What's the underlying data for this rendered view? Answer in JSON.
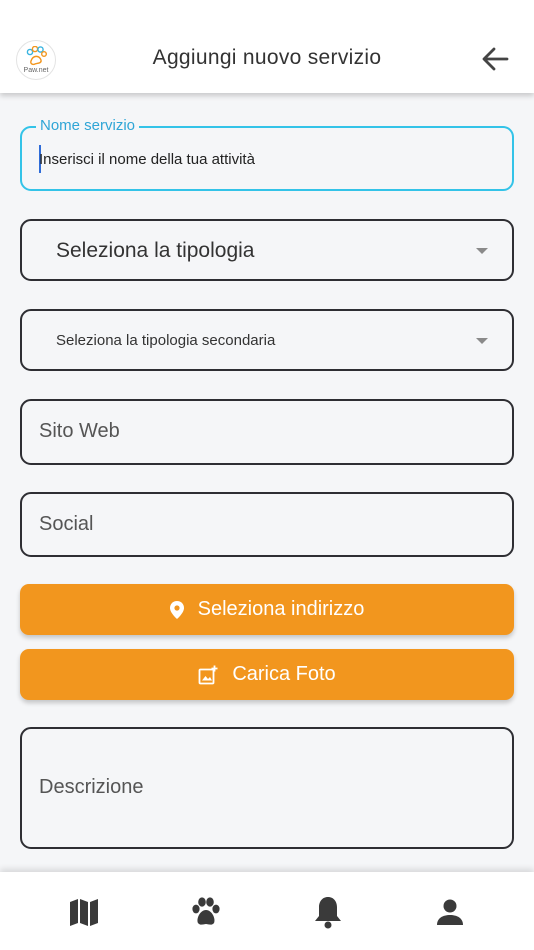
{
  "header": {
    "logo_text": "Paw.net",
    "title": "Aggiungi nuovo servizio"
  },
  "form": {
    "service_name": {
      "label": "Nome servizio",
      "value": "Inserisci il nome della tua attività"
    },
    "type_select": {
      "value": "Seleziona la tipologia"
    },
    "secondary_type_select": {
      "value": "Seleziona la tipologia secondaria"
    },
    "website": {
      "placeholder": "Sito Web"
    },
    "social": {
      "placeholder": "Social"
    },
    "address_button": {
      "label": "Seleziona indirizzo",
      "icon": "location-pin-icon"
    },
    "photo_button": {
      "label": "Carica Foto",
      "icon": "add-photo-icon"
    },
    "description": {
      "placeholder": "Descrizione"
    }
  },
  "bottom_nav": {
    "items": [
      {
        "icon": "map-icon"
      },
      {
        "icon": "paw-icon"
      },
      {
        "icon": "bell-icon"
      },
      {
        "icon": "person-icon"
      }
    ]
  },
  "colors": {
    "accent_orange": "#f2961e",
    "active_field": "#33c3e8",
    "label_blue": "#2fa5d6"
  }
}
